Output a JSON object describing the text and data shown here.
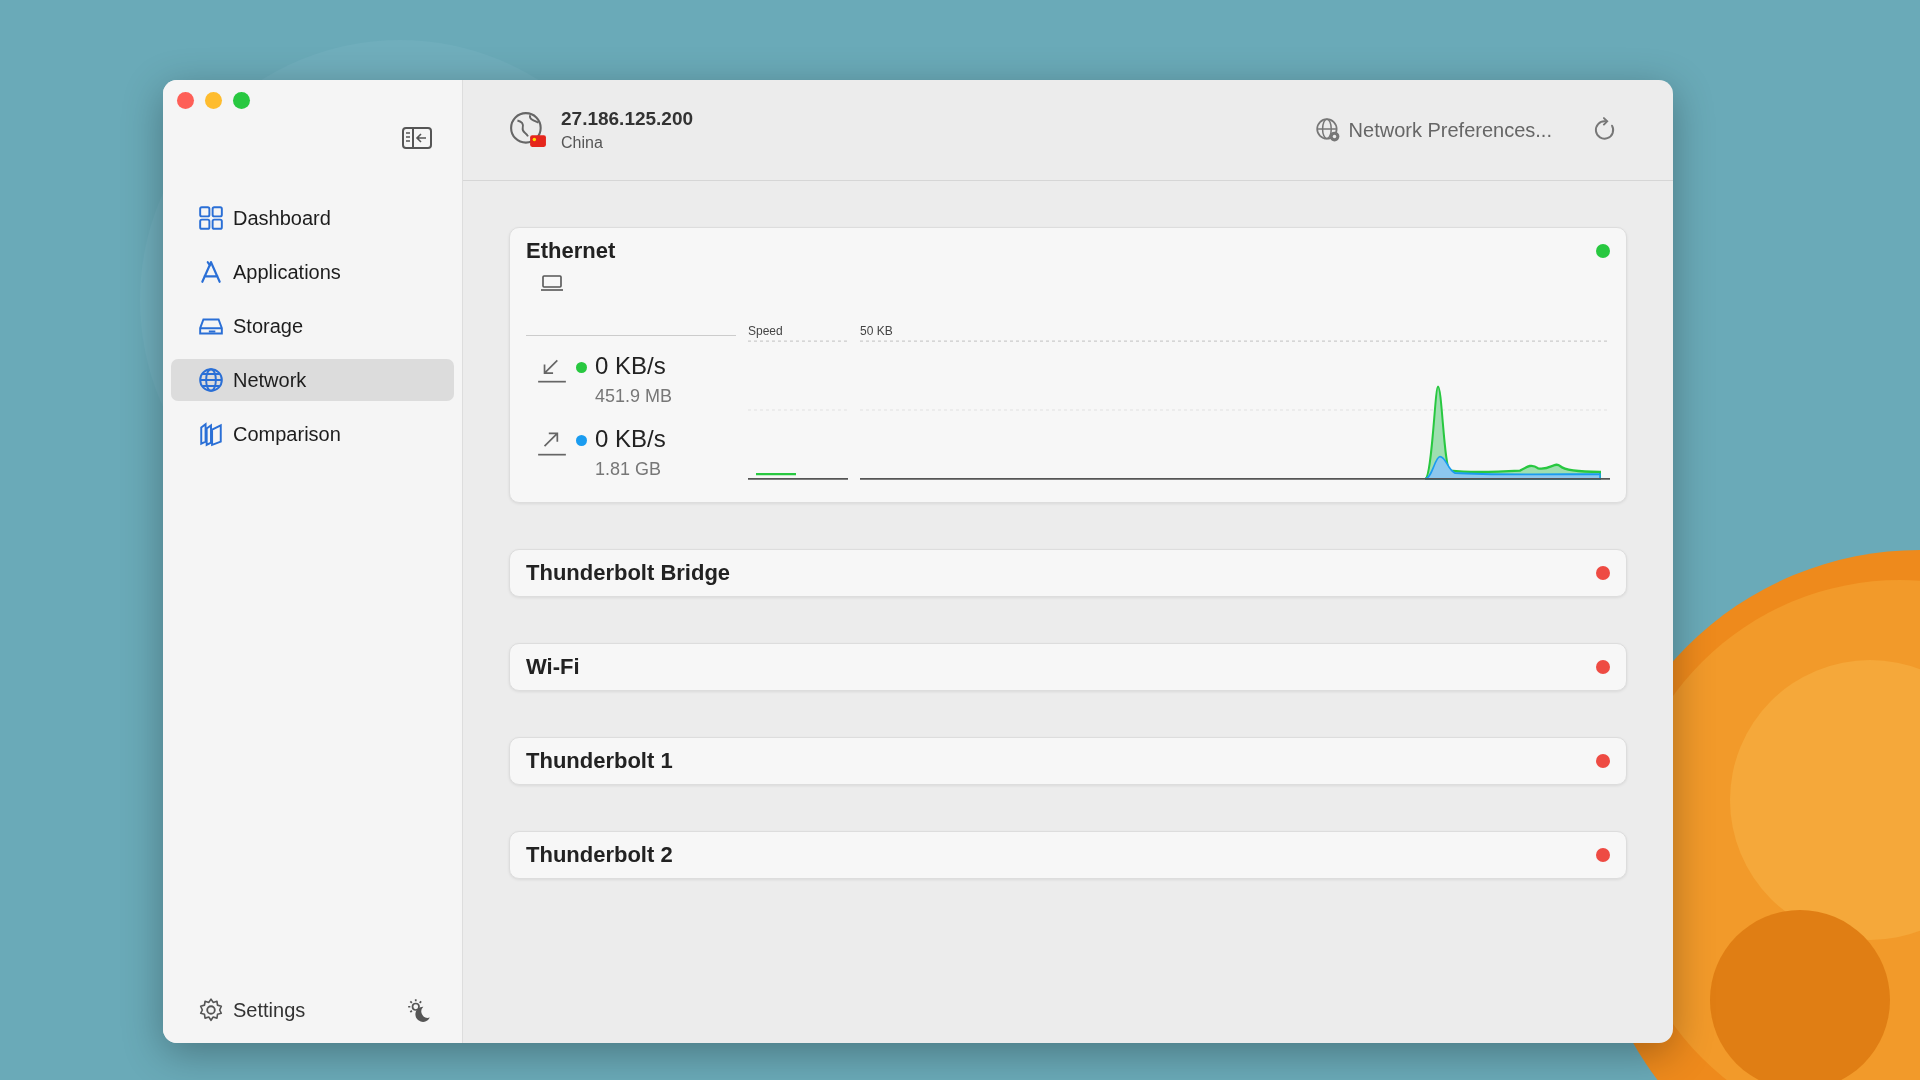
{
  "sidebar": {
    "items": [
      {
        "label": "Dashboard",
        "selected": false
      },
      {
        "label": "Applications",
        "selected": false
      },
      {
        "label": "Storage",
        "selected": false
      },
      {
        "label": "Network",
        "selected": true
      },
      {
        "label": "Comparison",
        "selected": false
      }
    ],
    "settings": "Settings"
  },
  "header": {
    "ip": "27.186.125.200",
    "country": "China",
    "preferences": "Network Preferences..."
  },
  "interfaces": [
    {
      "name": "Ethernet",
      "color": "#28c840",
      "expanded": true,
      "chart_labels": [
        "Speed",
        "50 KB"
      ],
      "traffic": [
        {
          "kind": "download",
          "color": "#28c840",
          "speed": "0 KB/s",
          "total": "451.9 MB"
        },
        {
          "kind": "upload",
          "color": "#1a9cf0",
          "speed": "0 KB/s",
          "total": "1.81 GB"
        }
      ]
    },
    {
      "name": "Thunderbolt Bridge",
      "color": "#ee4b43",
      "expanded": false
    },
    {
      "name": "Wi-Fi",
      "color": "#ee4b43",
      "expanded": false
    },
    {
      "name": "Thunderbolt 1",
      "color": "#ee4b43",
      "expanded": false
    },
    {
      "name": "Thunderbolt 2",
      "color": "#ee4b43",
      "expanded": false
    }
  ]
}
